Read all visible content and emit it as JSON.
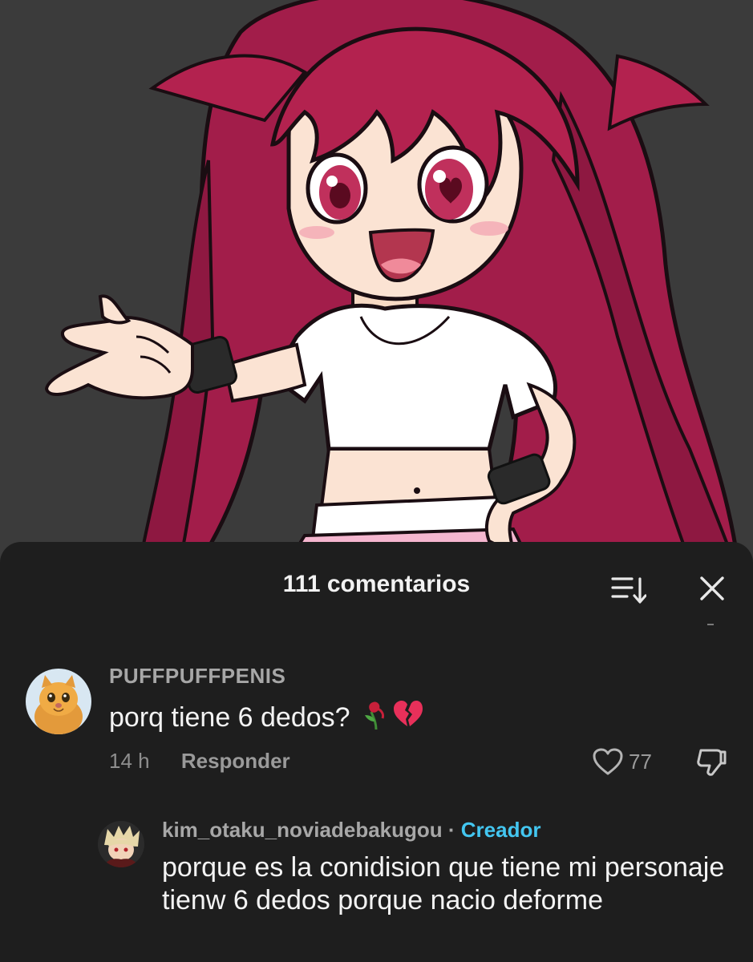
{
  "comments_sheet": {
    "title": "111 comentarios",
    "sort_icon": "sort-icon",
    "close_icon": "close-icon"
  },
  "comments": [
    {
      "username": "PUFFPUFFPENIS",
      "avatar_icon": "orange-cat-avatar",
      "text": "porq tiene 6 dedos?",
      "emojis": [
        "wilted-flower-emoji",
        "broken-heart-emoji"
      ],
      "time": "14 h",
      "reply_label": "Responder",
      "likes": "77",
      "like_icon": "heart-icon",
      "dislike_icon": "thumbs-down-icon"
    },
    {
      "username": "kim_otaku_noviadebakugou",
      "separator": " · ",
      "badge": "Creador",
      "avatar_icon": "anime-character-avatar",
      "text": "porque es la conidision que tiene mi personaje tienw 6 dedos porque nacio deforme"
    }
  ],
  "colors": {
    "sheet_background": "#1e1e1e",
    "creator_badge": "#43c6f0",
    "hair": "#b01f4f",
    "backdrop": "#3b3b3b"
  }
}
